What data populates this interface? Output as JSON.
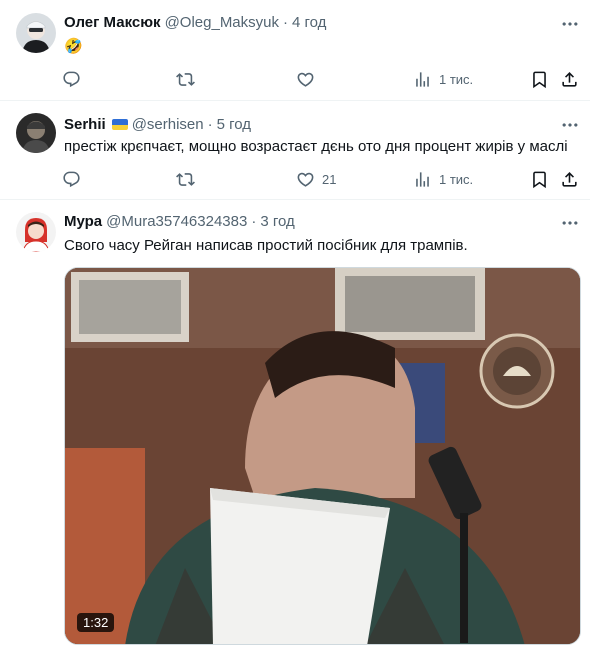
{
  "tweets": [
    {
      "name": "Олег Максюк",
      "handle": "@Oleg_Maksyuk",
      "time": "4 год",
      "text": "🤣",
      "likes": "",
      "views": "1 тис."
    },
    {
      "name": "Serhii",
      "handle": "@serhisen",
      "time": "5 год",
      "text": "престіж крєпчаєт, мощно возрастаєт дєнь ото дня процент жирів у маслі",
      "likes": "21",
      "views": "1 тис."
    },
    {
      "name": "Мура",
      "handle": "@Mura35746324383",
      "time": "3 год",
      "text": "Свого часу Рейган написав простий посібник для трампів.",
      "video_duration": "1:32"
    }
  ],
  "separator": "·",
  "icons": [
    "reply-icon",
    "retweet-icon",
    "like-icon",
    "views-icon",
    "bookmark-icon",
    "share-icon",
    "more-icon",
    "ukraine-flag-icon"
  ]
}
